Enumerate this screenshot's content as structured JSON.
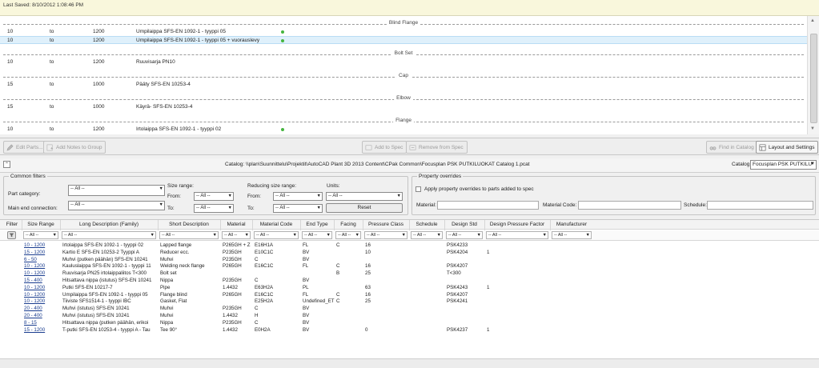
{
  "spec": {
    "last_saved": "Last Saved: 8/10/2012 1:08:46 PM",
    "sections": [
      {
        "label": "Blind Flange",
        "rows": [
          {
            "from": "10",
            "to": "to",
            "max": "1200",
            "desc": "Umpilaippa SFS-EN 1092-1 - tyyppi 05",
            "dot": true,
            "selected": false
          },
          {
            "from": "10",
            "to": "to",
            "max": "1200",
            "desc": "Umpilaippa SFS-EN 1092-1 - tyyppi 05 + vuorauslevy",
            "dot": true,
            "selected": true
          }
        ]
      },
      {
        "label": "Bolt Set",
        "rows": [
          {
            "from": "10",
            "to": "to",
            "max": "1200",
            "desc": "Ruuvisarja PN10",
            "dot": false,
            "selected": false
          }
        ]
      },
      {
        "label": "Cap",
        "rows": [
          {
            "from": "15",
            "to": "to",
            "max": "1000",
            "desc": "Pääty SFS-EN 10253-4",
            "dot": false,
            "selected": false
          }
        ]
      },
      {
        "label": "Elbow",
        "rows": [
          {
            "from": "15",
            "to": "to",
            "max": "1000",
            "desc": "Käyrä- SFS-EN 10253-4",
            "dot": false,
            "selected": false
          }
        ]
      },
      {
        "label": "Flange",
        "rows": [
          {
            "from": "10",
            "to": "to",
            "max": "1200",
            "desc": "Irtolaippa SFS-EN 1092-1 - tyyppi 02",
            "dot": true,
            "selected": false
          }
        ]
      }
    ]
  },
  "toolbar": {
    "edit_parts": "Edit Parts...",
    "add_notes": "Add Notes to Group",
    "add_to_spec": "Add to Spec",
    "remove_from_spec": "Remove from Spec",
    "find_in_catalog": "Find in Catalog",
    "layout_settings": "Layout and Settings"
  },
  "catalog": {
    "path": "Catalog: \\\\plan\\Suunnittelu\\Projektit\\AutoCAD Plant 3D 2013 Content\\CPak Common\\Focusplan PSK PUTKILUOKAT Catalog 1.pcat",
    "label": "Catalog:",
    "selected": "Focusplan PSK PUTKILU"
  },
  "filters": {
    "common_title": "Common filters",
    "part_category": "Part category:",
    "part_category_value": "-- All --",
    "main_end": "Main end connection:",
    "main_end_value": "-- All --",
    "size_range": "Size range:",
    "from": "From:",
    "to": "To:",
    "all": "-- All --",
    "reducing_size": "Reducing size range:",
    "units": "Units:",
    "reset": "Reset",
    "property_title": "Property overrides",
    "apply_overrides": "Apply property overrides to parts added to spec",
    "material": "Material:",
    "material_code": "Material Code:",
    "schedule": "Schedule:"
  },
  "grid": {
    "columns": [
      "Filter",
      "Size Range",
      "Long Description (Family)",
      "Short Description",
      "Material",
      "Material Code",
      "End Type",
      "Facing",
      "Pressure Class",
      "Schedule",
      "Design Std",
      "Design Pressure Factor",
      "Manufacturer"
    ],
    "filter_all": "-- All --",
    "rows": [
      [
        "10 - 1200",
        "Irtolaippa SFS-EN 1092-1 - tyyppi 02",
        "Lapped flange",
        "P265GH + Z",
        "E16H1A",
        "FL",
        "C",
        "16",
        "",
        "PSK4233",
        ""
      ],
      [
        "15 - 1200",
        "Kartio E SFS-EN 10253-2  Tyyppi A",
        "Reducer ecc.",
        "P235GH",
        "E10C1C",
        "BV",
        "",
        "10",
        "",
        "PSK4204",
        "1"
      ],
      [
        "6 - 50",
        "Muhvi (putken päähän) SFS-EN 10241",
        "Muhvi",
        "P235GH",
        "C",
        "BV",
        "",
        "",
        "",
        "",
        ""
      ],
      [
        "10 - 1200",
        "Kauluslaippa SFS-EN 1092-1 - tyyppi 11",
        "Welding neck flange",
        "P265GH",
        "E16C1C",
        "FL",
        "C",
        "16",
        "",
        "PSK4207",
        ""
      ],
      [
        "10 - 1200",
        "Ruuvisarja PN25 irtolaippaliitos T<300",
        "Bolt set",
        "",
        "",
        "",
        "B",
        "25",
        "",
        "T<300",
        ""
      ],
      [
        "15 - 400",
        "Hitsattava nippa (istutus) SFS-EN 10241",
        "Nippa",
        "P235GH",
        "C",
        "BV",
        "",
        "",
        "",
        "",
        ""
      ],
      [
        "10 - 1200",
        "Putki SFS-EN 10217-7",
        "Pipe",
        "1.4432",
        "E63H2A",
        "PL",
        "",
        "63",
        "",
        "PSK4243",
        "1"
      ],
      [
        "10 - 1200",
        "Umpilaippa SFS-EN 1092-1 - tyyppi 05",
        "Flange blind",
        "P265GH",
        "E16C1C",
        "FL",
        "C",
        "16",
        "",
        "PSK4207",
        ""
      ],
      [
        "10 - 1200",
        "Tiiviste SFS1514-1 - tyyppi IBC",
        "Gasket, Flat",
        "",
        "E25H2A",
        "Undefined_ET",
        "C",
        "25",
        "",
        "PSK4241",
        ""
      ],
      [
        "20 - 400",
        "Muhvi (istutus) SFS-EN 10241",
        "Muhvi",
        "P235GH",
        "C",
        "BV",
        "",
        "",
        "",
        "",
        ""
      ],
      [
        "20 - 400",
        "Muhvi (istutus) SFS-EN 10241",
        "Muhvi",
        "1.4432",
        "H",
        "BV",
        "",
        "",
        "",
        "",
        ""
      ],
      [
        "8 - 15",
        "Hitsattava nippa (putken päähän, erikoi",
        "Nippa",
        "P235GH",
        "C",
        "BV",
        "",
        "",
        "",
        "",
        ""
      ],
      [
        "15 - 1200",
        "T-putki SFS-EN 10253-4 - tyyppi A - Tau",
        "Tee 90°",
        "1.4432",
        "E0H2A",
        "BV",
        "",
        "0",
        "",
        "PSK4237",
        "1"
      ]
    ]
  }
}
